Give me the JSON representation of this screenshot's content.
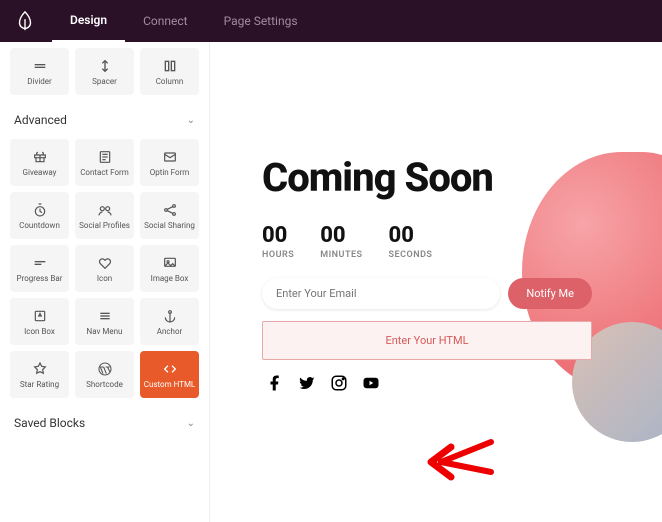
{
  "topbar": {
    "tabs": [
      {
        "label": "Design",
        "active": true
      },
      {
        "label": "Connect",
        "active": false
      },
      {
        "label": "Page Settings",
        "active": false
      }
    ]
  },
  "sidebar": {
    "row0": [
      {
        "icon": "divider",
        "label": "Divider"
      },
      {
        "icon": "spacer",
        "label": "Spacer"
      },
      {
        "icon": "column",
        "label": "Column"
      }
    ],
    "advanced_title": "Advanced",
    "advanced": [
      {
        "icon": "giveaway",
        "label": "Giveaway"
      },
      {
        "icon": "contact-form",
        "label": "Contact Form"
      },
      {
        "icon": "optin-form",
        "label": "Optin Form"
      },
      {
        "icon": "countdown",
        "label": "Countdown"
      },
      {
        "icon": "social-profiles",
        "label": "Social Profiles"
      },
      {
        "icon": "social-sharing",
        "label": "Social Sharing"
      },
      {
        "icon": "progress-bar",
        "label": "Progress Bar"
      },
      {
        "icon": "icon",
        "label": "Icon"
      },
      {
        "icon": "image-box",
        "label": "Image Box"
      },
      {
        "icon": "icon-box",
        "label": "Icon Box"
      },
      {
        "icon": "nav-menu",
        "label": "Nav Menu"
      },
      {
        "icon": "anchor",
        "label": "Anchor"
      },
      {
        "icon": "star-rating",
        "label": "Star Rating"
      },
      {
        "icon": "shortcode",
        "label": "Shortcode"
      },
      {
        "icon": "custom-html",
        "label": "Custom HTML",
        "active": true
      }
    ],
    "saved_title": "Saved Blocks"
  },
  "canvas": {
    "headline": "Coming Soon",
    "countdown": [
      {
        "value": "00",
        "label": "HOURS"
      },
      {
        "value": "00",
        "label": "MINUTES"
      },
      {
        "value": "00",
        "label": "SECONDS"
      }
    ],
    "email_placeholder": "Enter Your Email",
    "notify_label": "Notify Me",
    "html_placeholder": "Enter Your HTML",
    "socials": [
      "facebook",
      "twitter",
      "instagram",
      "youtube"
    ]
  }
}
